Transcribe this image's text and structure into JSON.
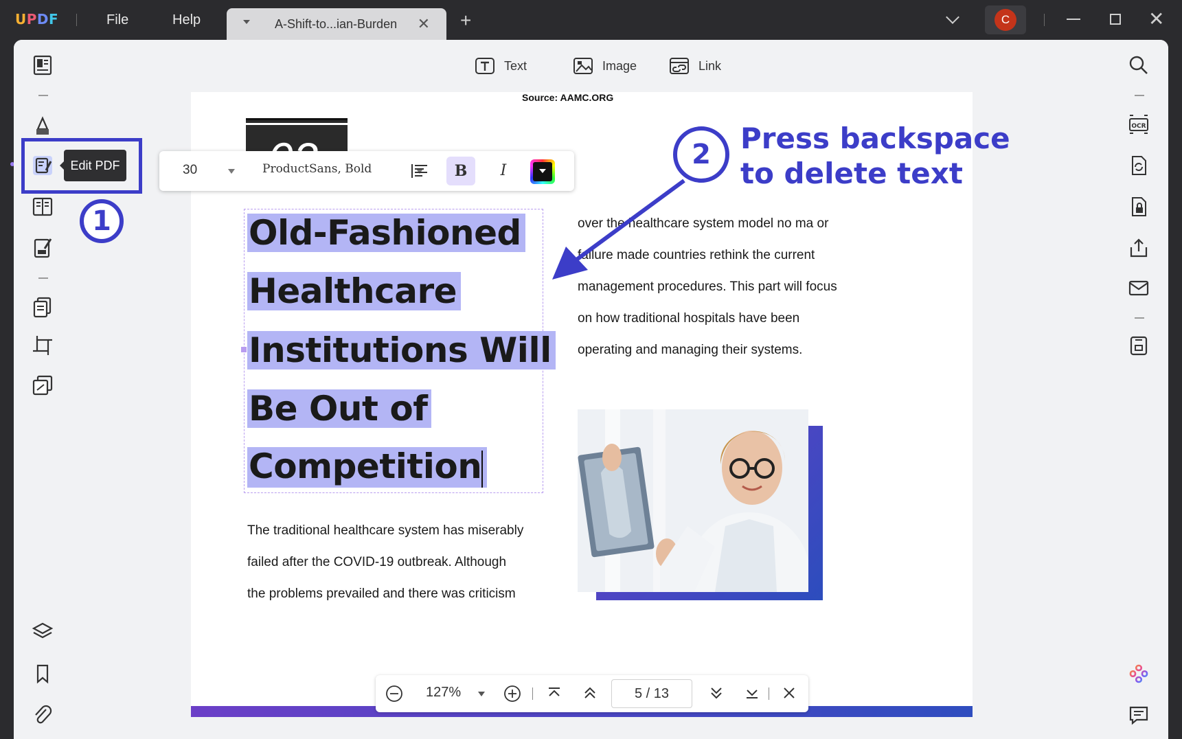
{
  "app": {
    "logo": "UPDF",
    "menu": {
      "file": "File",
      "help": "Help"
    },
    "tab": {
      "title": "A-Shift-to...ian-Burden",
      "close": "✕"
    },
    "new_tab": "+",
    "avatar_initial": "C"
  },
  "edit_toolbar": {
    "text_label": "Text",
    "image_label": "Image",
    "link_label": "Link"
  },
  "tooltip": {
    "edit_pdf": "Edit PDF"
  },
  "font_toolbar": {
    "size": "30",
    "font": "ProductSans, Bold",
    "bold": "B",
    "italic": "I"
  },
  "annotations": {
    "step1": "1",
    "step2": "2",
    "step2_text_line1": "Press backspace",
    "step2_text_line2": "to delete text",
    "accent_color": "#3c3dc8"
  },
  "page": {
    "source": "Source: AAMC.ORG",
    "number_label": "02",
    "headline_lines": [
      "Old-Fashioned",
      "Healthcare",
      "Institutions Will",
      "Be Out of",
      "Competition"
    ],
    "left_body": [
      "The traditional healthcare system has miserably",
      "failed after the COVID-19 outbreak. Although",
      "the problems prevailed and there was criticism"
    ],
    "right_body": [
      "over the healthcare system model  no ma or",
      "failure made countries rethink the current",
      "management procedures. This part will focus",
      "on how traditional hospitals have been",
      "operating and managing their systems."
    ]
  },
  "zoom_bar": {
    "zoom": "127%",
    "current_page": "5",
    "separator": "/",
    "total_pages": "13"
  }
}
